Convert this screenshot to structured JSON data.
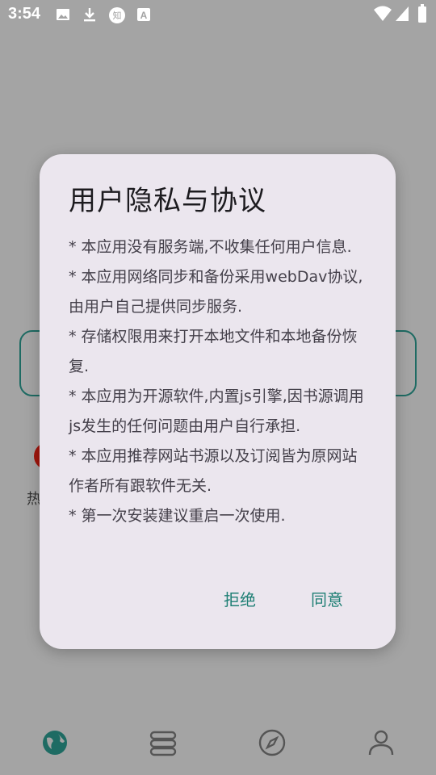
{
  "status_bar": {
    "time": "3:54",
    "icons": [
      "image-icon",
      "download-icon",
      "zhihu-icon",
      "translate-icon",
      "wifi-icon",
      "signal-icon",
      "battery-icon"
    ]
  },
  "background": {
    "hot_label": "热"
  },
  "bottom_nav": {
    "items": [
      {
        "icon": "globe-icon",
        "active": true
      },
      {
        "icon": "bookshelf-icon",
        "active": false
      },
      {
        "icon": "compass-icon",
        "active": false
      },
      {
        "icon": "person-icon",
        "active": false
      }
    ]
  },
  "dialog": {
    "title": "用户隐私与协议",
    "paragraphs": [
      "* 本应用没有服务端,不收集任何用户信息.",
      "* 本应用网络同步和备份采用webDav协议,由用户自己提供同步服务.",
      "* 存储权限用来打开本地文件和本地备份恢复.",
      "* 本应用为开源软件,内置js引擎,因书源调用js发生的任何问题由用户自行承担.",
      "* 本应用推荐网站书源以及订阅皆为原网站作者所有跟软件无关.",
      "* 第一次安装建议重启一次使用."
    ],
    "reject_label": "拒绝",
    "agree_label": "同意"
  },
  "colors": {
    "scrim": "#a4a4a4",
    "dialog_bg": "#ebe6ee",
    "accent": "#1e7f74",
    "nav_active": "#1e6b63"
  }
}
